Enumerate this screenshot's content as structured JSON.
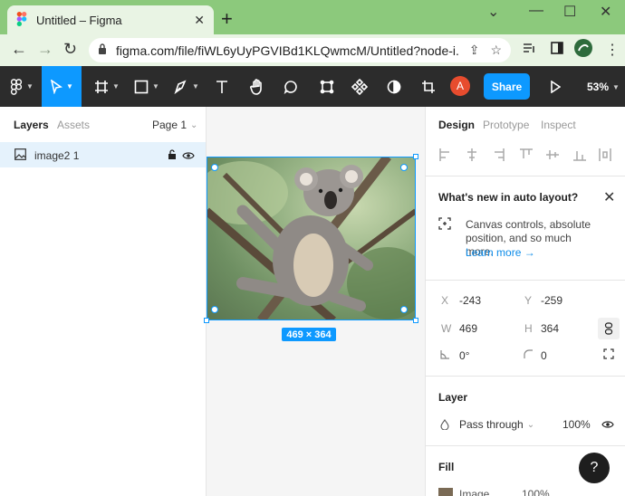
{
  "browser": {
    "tab_title": "Untitled – Figma",
    "url": "figma.com/file/fiWL6yUyPGVIBd1KLQwmcM/Untitled?node-i..."
  },
  "toolbar": {
    "share_label": "Share",
    "zoom": "53%",
    "avatar_initial": "A"
  },
  "left_panel": {
    "tabs": [
      "Layers",
      "Assets"
    ],
    "page_selector": "Page 1",
    "layers": [
      {
        "name": "image2 1"
      }
    ]
  },
  "canvas": {
    "dimension_label": "469 × 364"
  },
  "right_panel": {
    "tabs": [
      "Design",
      "Prototype",
      "Inspect"
    ],
    "whats_new": {
      "title": "What's new in auto layout?",
      "text": "Canvas controls, absolute position, and so much more.",
      "link": "Learn more →"
    },
    "props": {
      "x_label": "X",
      "x_value": "-243",
      "y_label": "Y",
      "y_value": "-259",
      "w_label": "W",
      "w_value": "469",
      "h_label": "H",
      "h_value": "364",
      "rotation": "0°",
      "radius": "0"
    },
    "layer_section": {
      "title": "Layer",
      "blend_mode": "Pass through",
      "opacity": "100%"
    },
    "fill_section": {
      "title": "Fill",
      "type": "Image",
      "opacity": "100%"
    },
    "help_label": "?"
  },
  "colors": {
    "figma_blue": "#0d99ff",
    "toolbar_bg": "#2c2c2c",
    "browser_tab_strip": "#8cc97c",
    "avatar": "#e74c2e"
  }
}
